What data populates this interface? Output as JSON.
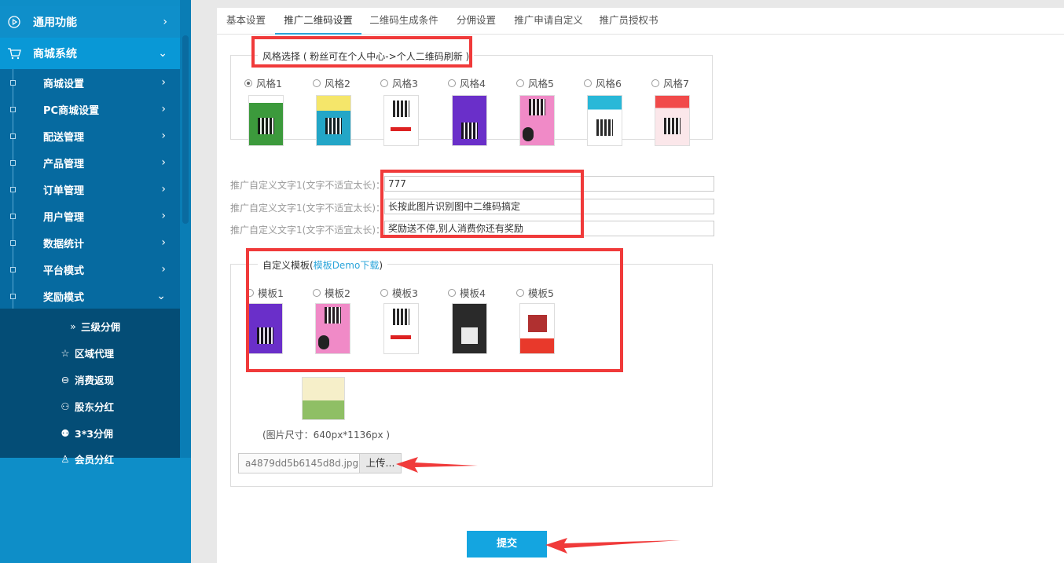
{
  "sidebar": {
    "top": [
      {
        "label": "通用功能",
        "icon": "play-circle-icon",
        "expanded": false
      },
      {
        "label": "商城系统",
        "icon": "cart-icon",
        "expanded": true
      }
    ],
    "items": [
      {
        "label": "商城设置"
      },
      {
        "label": "PC商城设置"
      },
      {
        "label": "配送管理"
      },
      {
        "label": "产品管理"
      },
      {
        "label": "订单管理"
      },
      {
        "label": "用户管理"
      },
      {
        "label": "数据统计"
      },
      {
        "label": "平台模式"
      },
      {
        "label": "奖励模式",
        "expanded": true
      }
    ],
    "reward_items": [
      {
        "label": "三级分佣",
        "icon": "double-chevron-icon",
        "glyph": "»"
      },
      {
        "label": "区域代理",
        "icon": "star-icon",
        "glyph": "☆"
      },
      {
        "label": "消费返现",
        "icon": "circle-arrow-icon",
        "glyph": "⊖"
      },
      {
        "label": "股东分红",
        "icon": "users-icon",
        "glyph": "⚇"
      },
      {
        "label": "3*3分佣",
        "icon": "org-chart-icon",
        "glyph": "⚉"
      },
      {
        "label": "会员分红",
        "icon": "user-icon",
        "glyph": "♙"
      }
    ]
  },
  "tabs": [
    {
      "label": "基本设置",
      "active": false
    },
    {
      "label": "推广二维码设置",
      "active": true
    },
    {
      "label": "二维码生成条件",
      "active": false
    },
    {
      "label": "分佣设置",
      "active": false
    },
    {
      "label": "推广申请自定义",
      "active": false
    },
    {
      "label": "推广员授权书",
      "active": false
    }
  ],
  "style_section": {
    "legend": "风格选择 ( 粉丝可在个人中心->个人二维码刷新 )",
    "options": [
      "风格1",
      "风格2",
      "风格3",
      "风格4",
      "风格5",
      "风格6",
      "风格7"
    ],
    "selected": 0
  },
  "custom_text": [
    {
      "label": "推广自定义文字1(文字不适宜太长)：",
      "value": "777"
    },
    {
      "label": "推广自定义文字1(文字不适宜太长)：",
      "value": "长按此图片识别图中二维码搞定"
    },
    {
      "label": "推广自定义文字1(文字不适宜太长)：",
      "value": "奖励送不停,别人消费你还有奖励"
    }
  ],
  "template_section": {
    "legend_prefix": "自定义模板(",
    "legend_link": "模板Demo下载",
    "legend_suffix": ")",
    "options": [
      "模板1",
      "模板2",
      "模板3",
      "模板4",
      "模板5"
    ],
    "size_note": "(图片尺寸：640px*1136px )"
  },
  "upload": {
    "filename": "a4879dd5b6145d8d.jpg",
    "button": "上传..."
  },
  "submit": {
    "label": "提交"
  },
  "colors": {
    "sidebar": "#0e8ec8",
    "accent": "#14a5e0",
    "highlight": "#f03a3a"
  }
}
